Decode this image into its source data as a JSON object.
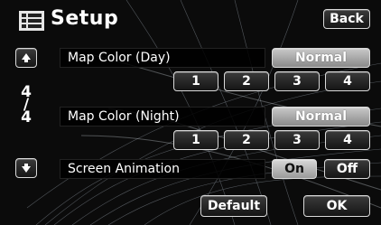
{
  "header": {
    "title": "Setup",
    "back_label": "Back"
  },
  "pager": {
    "up_icon": "arrow-up-icon",
    "down_icon": "arrow-down-icon",
    "current": "4",
    "separator": "/",
    "total": "4"
  },
  "rows": {
    "map_color_day": {
      "label": "Map Color (Day)",
      "mode_label": "Normal",
      "options": [
        "1",
        "2",
        "3",
        "4"
      ]
    },
    "map_color_night": {
      "label": "Map Color (Night)",
      "mode_label": "Normal",
      "options": [
        "1",
        "2",
        "3",
        "4"
      ]
    },
    "screen_animation": {
      "label": "Screen Animation",
      "on_label": "On",
      "off_label": "Off",
      "selected": "On"
    }
  },
  "footer": {
    "default_label": "Default",
    "ok_label": "OK"
  },
  "colors": {
    "background": "#0b0b0b",
    "button_selected": "#bdbdbd",
    "accent_line": "#9aa4b0"
  }
}
